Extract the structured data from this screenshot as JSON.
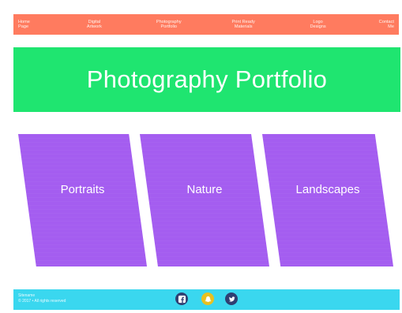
{
  "colors": {
    "nav_bg": "#ff7b5f",
    "hero_bg": "#1fe570",
    "card_bg": "#a45df0",
    "footer_bg": "#3ad7ef"
  },
  "nav": {
    "items": [
      {
        "label": "Home\nPage"
      },
      {
        "label": "Digital\nArtwork"
      },
      {
        "label": "Photography\nPortfolio"
      },
      {
        "label": "Print Ready\nMaterials"
      },
      {
        "label": "Logo\nDesigns"
      },
      {
        "label": "Contact\nMe"
      }
    ]
  },
  "hero": {
    "title": "Photography Portfolio"
  },
  "cards": [
    {
      "label": "Portraits"
    },
    {
      "label": "Nature"
    },
    {
      "label": "Landscapes"
    }
  ],
  "footer": {
    "text": "Sitename\n© 2017 • All rights reserved",
    "social_icons": [
      "facebook-icon",
      "snapchat-icon",
      "twitter-icon"
    ]
  }
}
